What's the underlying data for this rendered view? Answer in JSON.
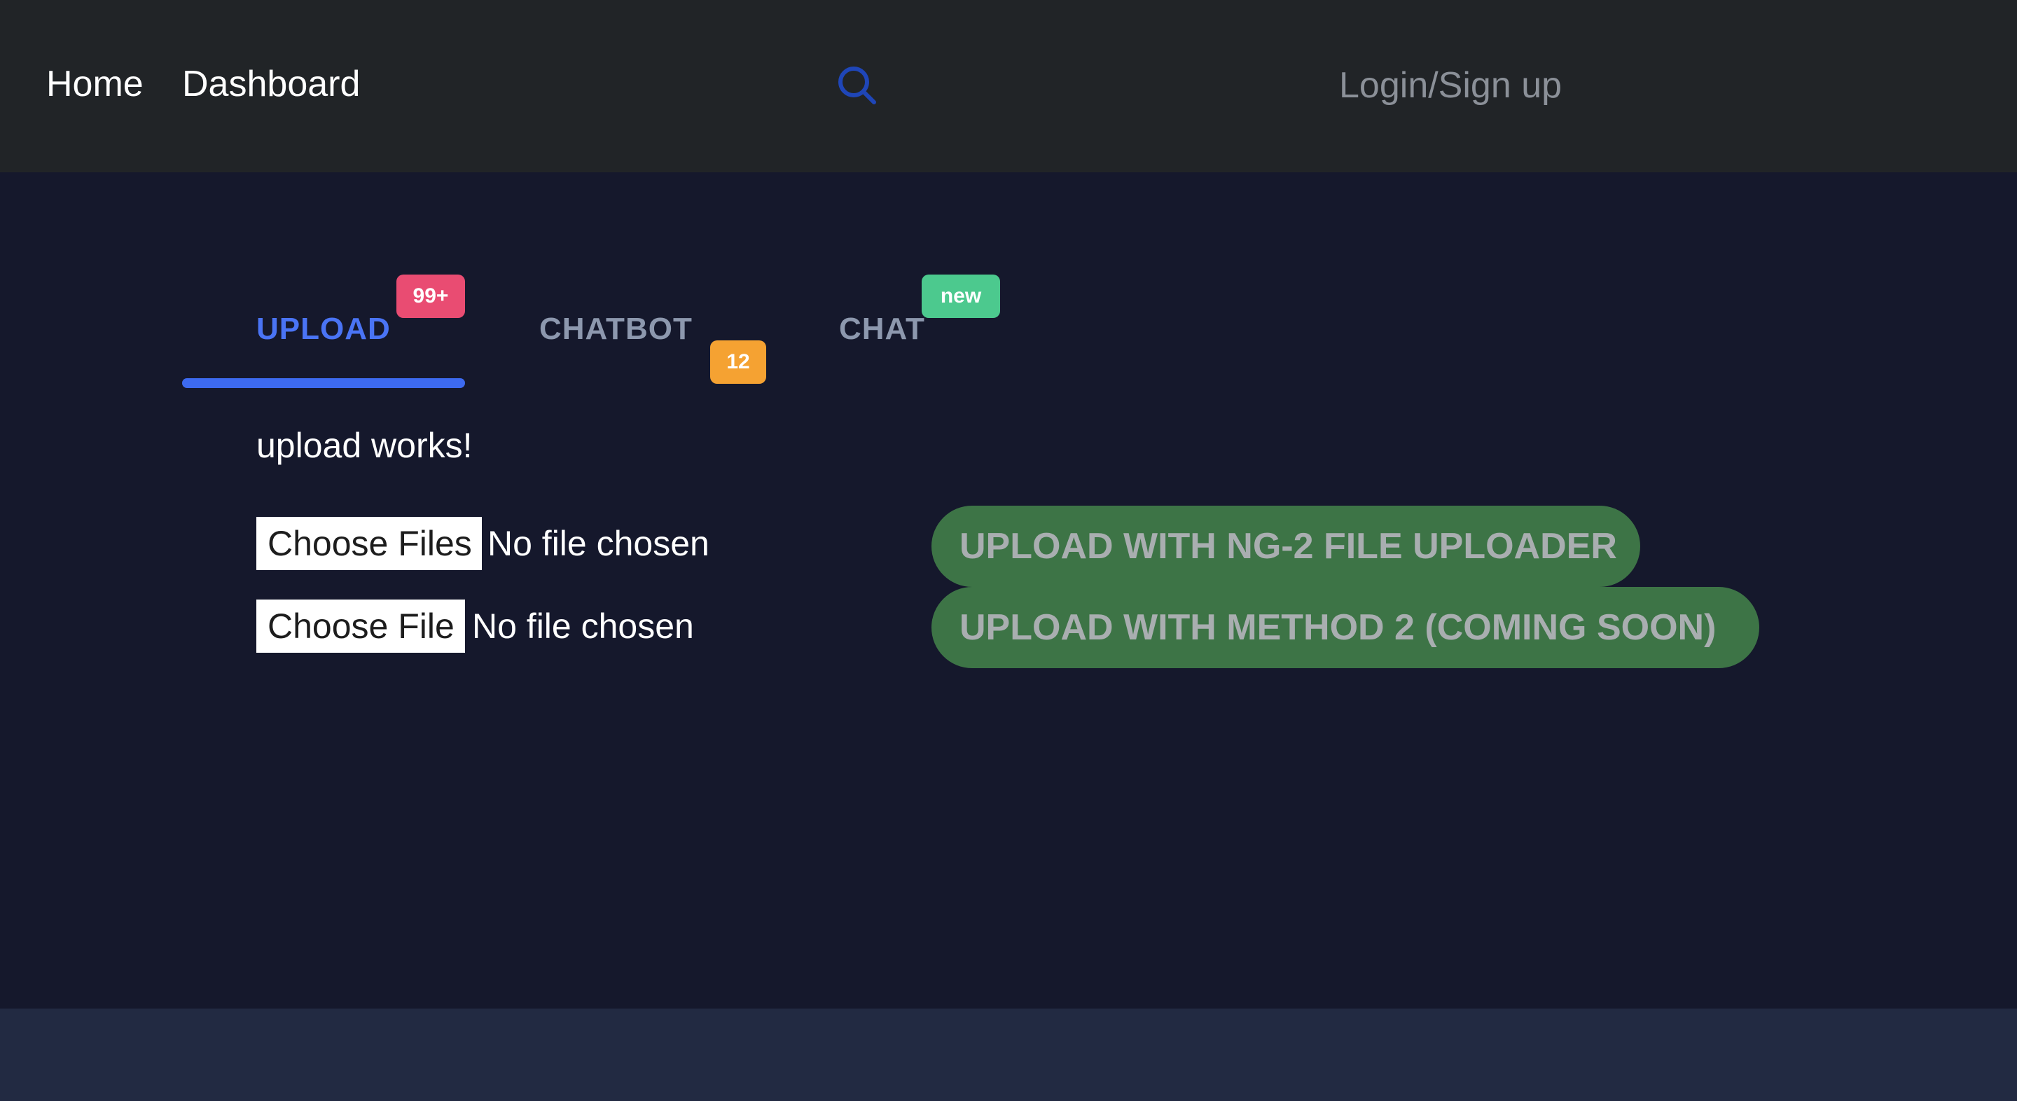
{
  "header": {
    "nav": [
      "Home",
      "Dashboard"
    ],
    "search_icon": "search-icon",
    "login_label": "Login/Sign up"
  },
  "tabs": [
    {
      "label": "UPLOAD",
      "badge": "99+",
      "badge_color": "#e94c72",
      "active": true
    },
    {
      "label": "CHATBOT",
      "badge": "12",
      "badge_color": "#f5a232",
      "active": false
    },
    {
      "label": "CHAT",
      "badge": "new",
      "badge_color": "#4cc98e",
      "active": false
    }
  ],
  "upload": {
    "status_text": "upload works!",
    "multi_file_button": "Choose Files",
    "multi_file_status": "No file chosen",
    "single_file_button": "Choose File",
    "single_file_status": "No file chosen",
    "ng2_button": "UPLOAD WITH NG-2 FILE UPLOADER",
    "method2_button": "UPLOAD WITH METHOD 2 (COMING SOON)"
  },
  "colors": {
    "topbar": "#212427",
    "main_background": "#15182c",
    "footer": "#222a42",
    "accent": "#3d6af0",
    "upload_button": "#3d7446"
  }
}
